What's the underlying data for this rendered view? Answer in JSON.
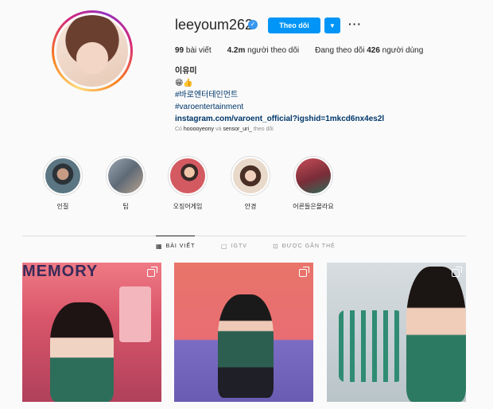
{
  "profile": {
    "username": "leeyoum262",
    "follow_label": "Theo dõi",
    "posts_count": "99",
    "posts_label": "bài viết",
    "followers_count": "4.2m",
    "followers_label": "người theo dõi",
    "following_prefix": "Đang theo dõi",
    "following_count": "426",
    "following_label": "người dùng"
  },
  "bio": {
    "name": "이유미",
    "emoji": "😁👍",
    "tag1": "#바로엔터테인먼트",
    "tag2": "#varoentertainment",
    "link": "instagram.com/varoent_official?igshid=1mkcd6nx4es2l",
    "followed_prefix": "Có",
    "followed_user1": "hooooyeony",
    "followed_and": "và",
    "followed_user2": "sensor_uri_",
    "followed_suffix": "theo dõi"
  },
  "highlights": [
    {
      "label": "인질",
      "color": "#3a4b55"
    },
    {
      "label": "팁",
      "color": "#7c8a96"
    },
    {
      "label": "오징어게임",
      "color": "#c24a58"
    },
    {
      "label": "안경",
      "color": "#d8b29f"
    },
    {
      "label": "어른들은몰라요",
      "color": "#8a3a44"
    }
  ],
  "tabs": {
    "posts": "BÀI VIẾT",
    "igtv": "IGTV",
    "tagged": "ĐƯỢC GẮN THẺ"
  },
  "posts": {
    "p1_sign": "MEMORY"
  },
  "colors": {
    "accent": "#0095f6",
    "verified": "#3897f0",
    "link": "#00376b"
  }
}
